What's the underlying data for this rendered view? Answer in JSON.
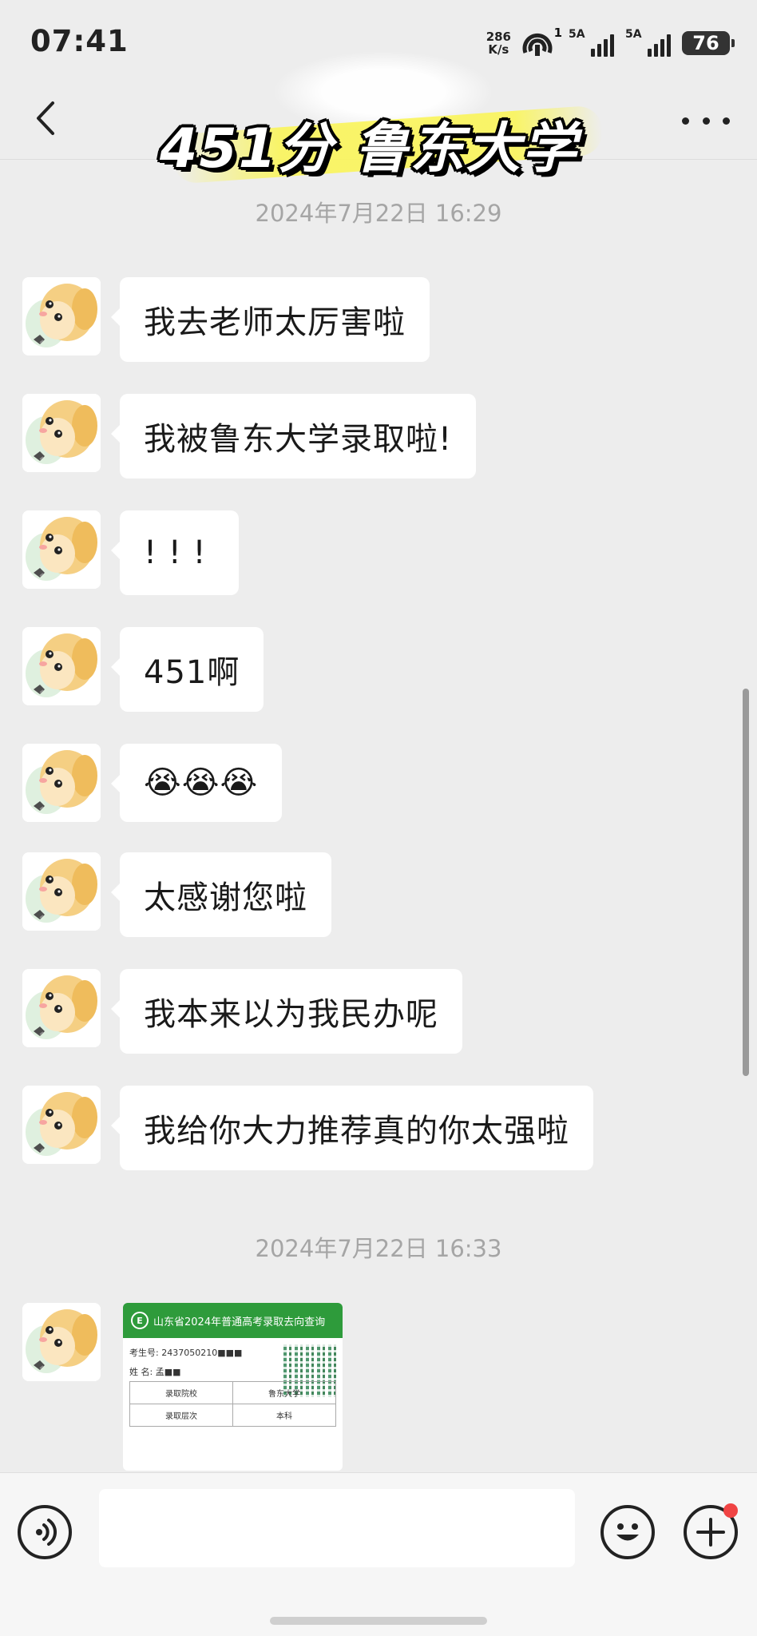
{
  "status_bar": {
    "time": "07:41",
    "net_speed_value": "286",
    "net_speed_unit": "K/s",
    "wifi_badge": "1",
    "sim1_label": "5A",
    "sim2_label": "5A",
    "battery": "76"
  },
  "overlay": {
    "caption": "451分  鲁东大学"
  },
  "chat": {
    "timestamp_1": "2024年7月22日 16:29",
    "timestamp_2": "2024年7月22日 16:33",
    "messages": [
      "我去老师太厉害啦",
      "我被鲁东大学录取啦!",
      "!  !  !",
      "451啊",
      "😭😭😭",
      "太感谢您啦",
      "我本来以为我民办呢",
      "我给你大力推荐真的你太强啦"
    ],
    "image_message": {
      "header": "山东省2024年普通高考录取去向查询",
      "exam_no_label": "考生号:",
      "exam_no_value": "2437050210■■■",
      "name_label": "姓  名:",
      "name_value": "孟■■",
      "row1_label": "录取院校",
      "row1_value": "鲁东大学",
      "row2_label": "录取层次",
      "row2_value": "本科"
    }
  },
  "input_bar": {
    "text_value": ""
  }
}
